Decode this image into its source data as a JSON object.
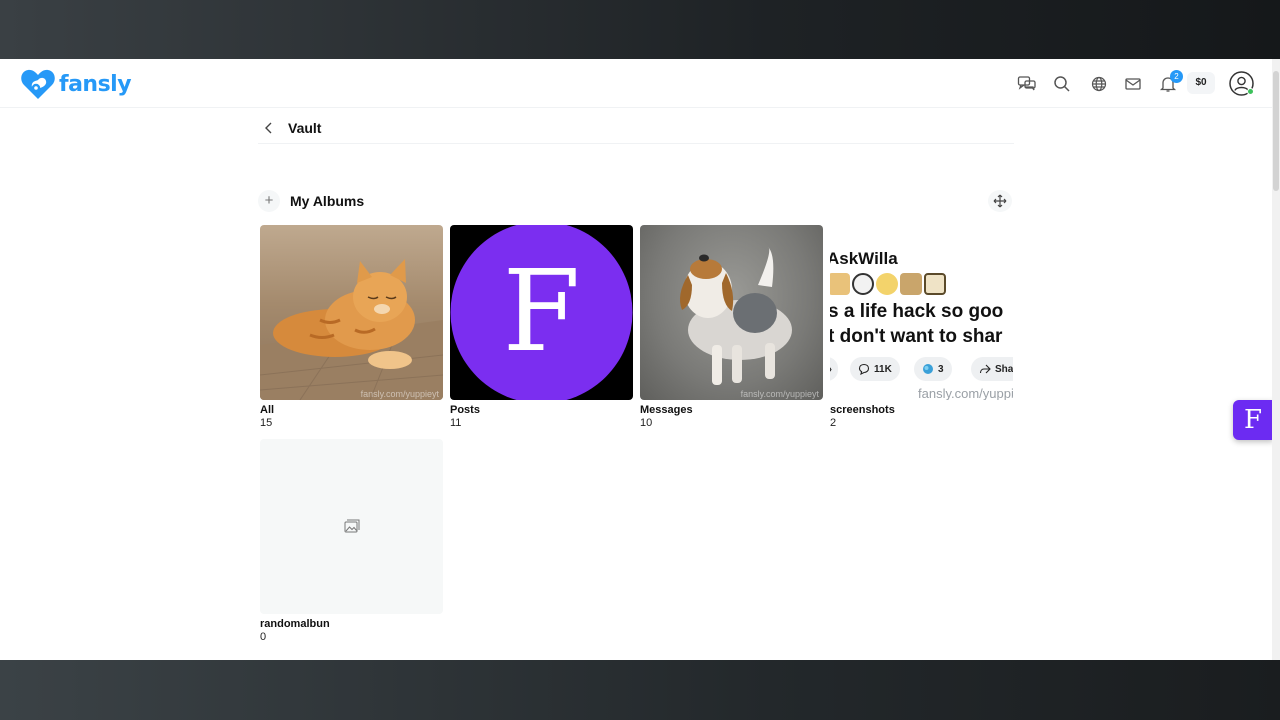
{
  "app": {
    "logo_text": "fansly",
    "brand_color": "#2699f7"
  },
  "header": {
    "icons": [
      "chat-rooms-icon",
      "search-icon",
      "globe-icon",
      "mail-icon",
      "bell-icon"
    ],
    "notifications_count": "2",
    "balance": "$0"
  },
  "page": {
    "title": "Vault"
  },
  "albums_section": {
    "title": "My Albums",
    "add_symbol": "+"
  },
  "albums": [
    {
      "name": "All",
      "count": "15",
      "thumb": "orange-cat-photo",
      "watermark": "fansly.com/yuppieyt"
    },
    {
      "name": "Posts",
      "count": "11",
      "thumb": "fansly-f-logo",
      "thumb_letter": "F"
    },
    {
      "name": "Messages",
      "count": "10",
      "thumb": "beagle-puppy-photo",
      "watermark": "fansly.com/yuppieyt"
    },
    {
      "name": "screenshots",
      "count": "2",
      "thumb": "social-post-screenshot"
    },
    {
      "name": "randomalbun",
      "count": "0",
      "thumb": "empty-image-icon"
    }
  ],
  "screenshot_thumb": {
    "handle": "AskWilla",
    "line1": "s a life hack so goo",
    "line2": "t don't want to shar",
    "replies": "11K",
    "retweets": "3",
    "share": "Sha",
    "watermark": "fansly.com/yuppi"
  },
  "floating_button": {
    "letter": "F",
    "color": "#6c2bf2"
  }
}
